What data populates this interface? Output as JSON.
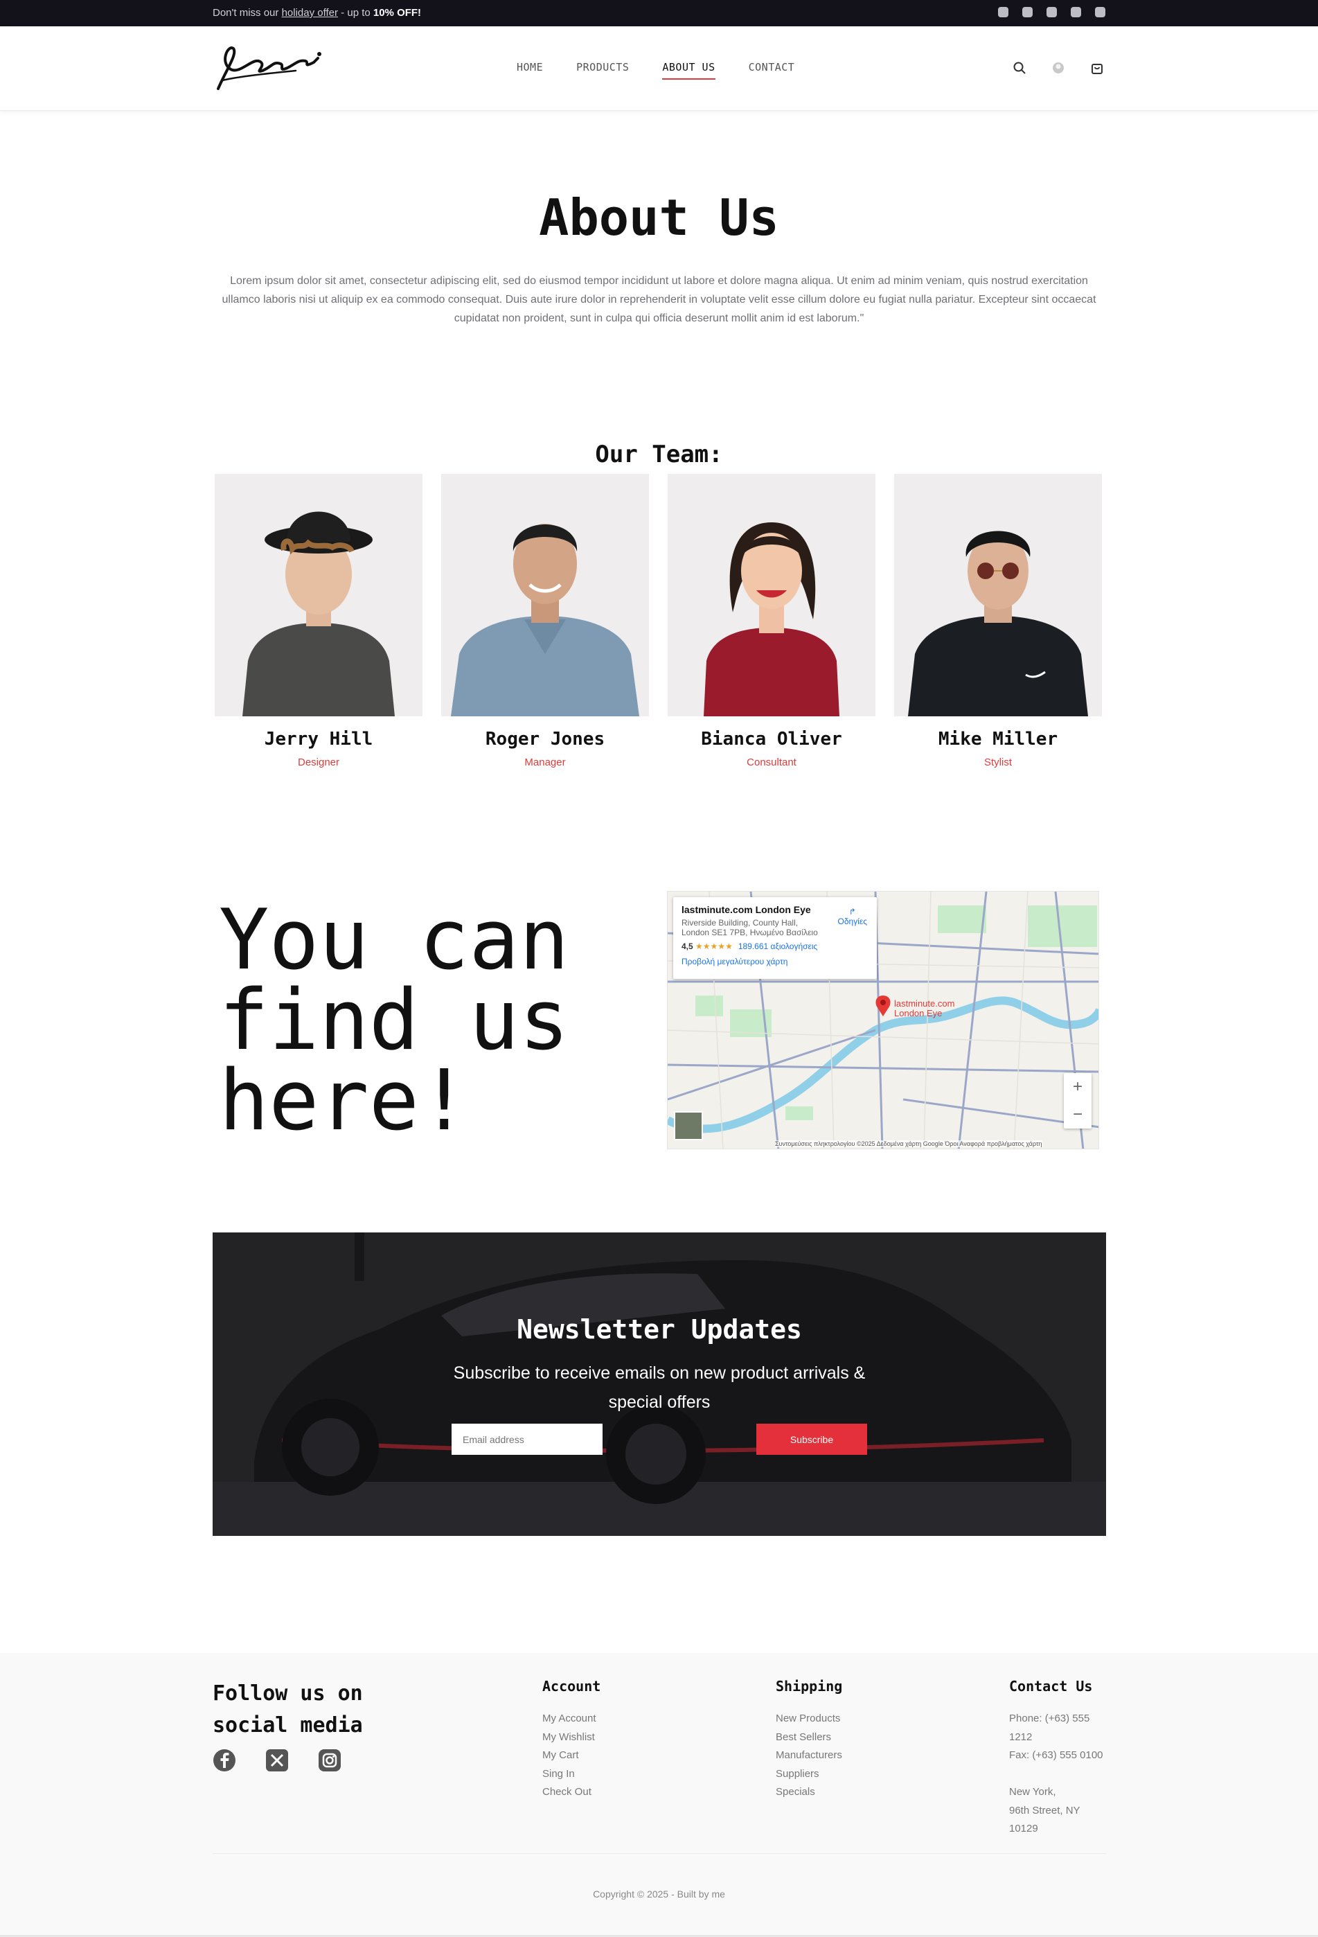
{
  "announcement": {
    "prefix": "Don't miss our ",
    "link": "holiday offer",
    "middle": " - up to ",
    "highlight": "10% OFF!",
    "social_icons": [
      "facebook-icon",
      "x-icon",
      "instagram-icon",
      "mail-icon",
      "phone-icon"
    ]
  },
  "header": {
    "logo_alt": "Logotypini",
    "nav": [
      {
        "label": "HOME"
      },
      {
        "label": "PRODUCTS"
      },
      {
        "label": "ABOUT US"
      },
      {
        "label": "CONTACT"
      }
    ],
    "active_nav": "ABOUT US",
    "icons": [
      "search-icon",
      "user-icon",
      "cart-icon"
    ]
  },
  "about": {
    "title": "About Us",
    "text": "Lorem ipsum dolor sit amet, consectetur adipiscing elit, sed do eiusmod tempor incididunt ut labore et dolore magna aliqua. Ut enim ad minim veniam, quis nostrud exercitation ullamco laboris nisi ut aliquip ex ea commodo consequat. Duis aute irure dolor in reprehenderit in voluptate velit esse cillum dolore eu fugiat nulla pariatur. Excepteur sint occaecat cupidatat non proident, sunt in culpa qui officia deserunt mollit anim id est laborum.\""
  },
  "team": {
    "title": "Our Team:",
    "members": [
      {
        "name": "Jerry Hill",
        "role": "Designer"
      },
      {
        "name": "Roger Jones",
        "role": "Manager"
      },
      {
        "name": "Bianca Oliver",
        "role": "Consultant"
      },
      {
        "name": "Mike Miller",
        "role": "Stylist"
      }
    ]
  },
  "find": {
    "line1": "You can",
    "line2": "find us",
    "line3": "here!"
  },
  "map": {
    "place": "lastminute.com London Eye",
    "address_1": "Riverside Building, County Hall,",
    "address_2": "London SE1 7PB, Ηνωμένο Βασίλειο",
    "rating": "4,5",
    "stars": "★★★★★",
    "reviews": "189.661 αξιολογήσεις",
    "larger_map": "Προβολή μεγαλύτερου χάρτη",
    "directions": "Οδηγίες",
    "pin_label": "lastminute.com London Eye",
    "zoom_in": "+",
    "zoom_out": "−",
    "footer": "Συντομεύσεις πληκτρολογίου   ©2025 Δεδομένα χάρτη Google   Όροι   Αναφορά προβλήματος χάρτη"
  },
  "newsletter": {
    "title": "Newsletter Updates",
    "subtitle_1": "Subscribe to receive emails on new product arrivals &",
    "subtitle_2": "special offers",
    "email_placeholder": "Email address",
    "button": "Subscribe"
  },
  "footer": {
    "follow_1": "Follow us on",
    "follow_2": "social media",
    "social_icons": [
      "facebook-icon",
      "x-icon",
      "instagram-icon"
    ],
    "account": {
      "title": "Account",
      "items": [
        "My Account",
        "My Wishlist",
        "My Cart",
        "Sing In",
        "Check Out"
      ]
    },
    "shipping": {
      "title": "Shipping",
      "items": [
        "New Products",
        "Best Sellers",
        "Manufacturers",
        "Suppliers",
        "Specials"
      ]
    },
    "contact": {
      "title": "Contact Us",
      "items": [
        "Phone: (+63) 555",
        "1212",
        "Fax: (+63) 555 0100",
        "",
        "New York,",
        "96th Street, NY",
        "10129"
      ]
    },
    "copyright": "Copyright © 2025 - Built by me"
  },
  "colors": {
    "accent": "#e03a3a",
    "topbar": "#13111a",
    "button": "#e3303a"
  }
}
